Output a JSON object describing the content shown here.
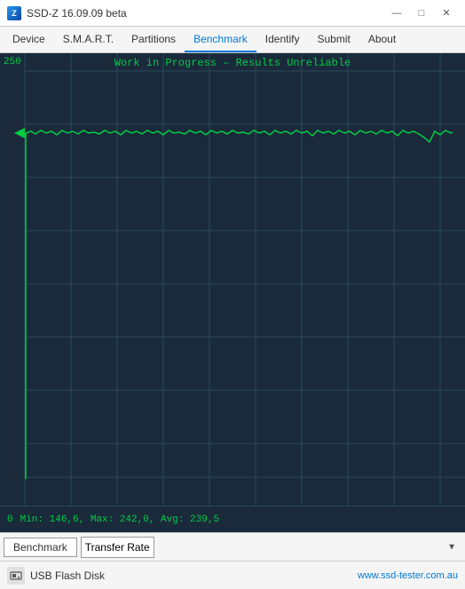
{
  "titleBar": {
    "icon": "Z",
    "title": "SSD-Z 16.09.09 beta",
    "minimize": "—",
    "maximize": "□",
    "close": "✕"
  },
  "menuBar": {
    "items": [
      {
        "label": "Device",
        "active": false
      },
      {
        "label": "S.M.A.R.T.",
        "active": false
      },
      {
        "label": "Partitions",
        "active": false
      },
      {
        "label": "Benchmark",
        "active": true
      },
      {
        "label": "Identify",
        "active": false
      },
      {
        "label": "Submit",
        "active": false
      },
      {
        "label": "About",
        "active": false
      }
    ]
  },
  "chart": {
    "title": "Work in Progress – Results Unreliable",
    "yLabelTop": "250",
    "yLabelBottom": "0",
    "statsText": "Min: 146,6, Max: 242,0, Avg: 239,5"
  },
  "toolbar": {
    "benchmarkLabel": "Benchmark",
    "selectValue": "Transfer Rate",
    "selectArrow": "▼"
  },
  "statusBar": {
    "driveLabel": "USB Flash Disk",
    "website": "www.ssd-tester.com.au"
  }
}
